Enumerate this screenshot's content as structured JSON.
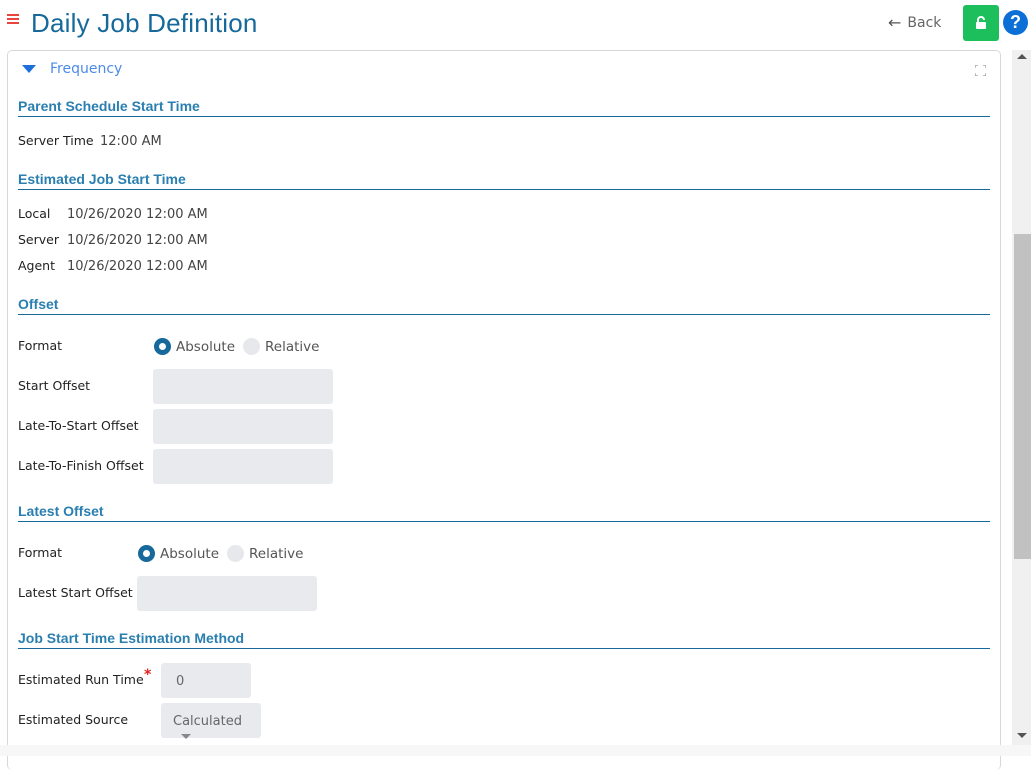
{
  "header": {
    "title": "Daily Job Definition",
    "back_label": "Back",
    "lock_icon": "unlock-icon",
    "help_icon": "question-icon"
  },
  "panel": {
    "title": "Frequency",
    "expand_icon": "expand-icon"
  },
  "parent_schedule": {
    "heading": "Parent Schedule Start Time",
    "server_time_label": "Server Time",
    "server_time_value": "12:00 AM"
  },
  "estimated_start": {
    "heading": "Estimated Job Start Time",
    "rows": [
      {
        "label": "Local",
        "value": "10/26/2020 12:00 AM"
      },
      {
        "label": "Server",
        "value": "10/26/2020 12:00 AM"
      },
      {
        "label": "Agent",
        "value": "10/26/2020 12:00 AM"
      }
    ]
  },
  "offset": {
    "heading": "Offset",
    "format_label": "Format",
    "options": [
      "Absolute",
      "Relative"
    ],
    "selected": "Absolute",
    "start_offset_label": "Start Offset",
    "start_offset_value": "",
    "late_to_start_label": "Late-To-Start Offset",
    "late_to_start_value": "",
    "late_to_finish_label": "Late-To-Finish Offset",
    "late_to_finish_value": ""
  },
  "latest_offset": {
    "heading": "Latest Offset",
    "format_label": "Format",
    "options": [
      "Absolute",
      "Relative"
    ],
    "selected": "Absolute",
    "latest_start_label": "Latest Start Offset",
    "latest_start_value": ""
  },
  "estimation": {
    "heading": "Job Start Time Estimation Method",
    "run_time_label": "Estimated Run Time",
    "run_time_required": "*",
    "run_time_value": "0",
    "source_label": "Estimated Source",
    "source_value": "Calculated"
  },
  "colors": {
    "accent": "#16699a",
    "lock_button": "#1dbf5d",
    "help": "#0b6fd6",
    "required": "#e0201c"
  }
}
